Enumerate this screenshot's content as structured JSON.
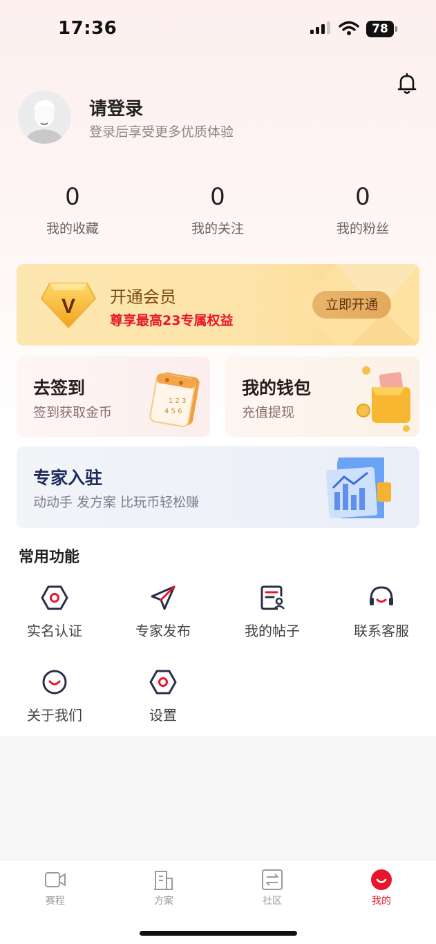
{
  "status_bar": {
    "time": "17:36",
    "battery": "78"
  },
  "profile": {
    "title": "请登录",
    "subtitle": "登录后享受更多优质体验"
  },
  "stats": [
    {
      "value": "0",
      "label": "我的收藏"
    },
    {
      "value": "0",
      "label": "我的关注"
    },
    {
      "value": "0",
      "label": "我的粉丝"
    }
  ],
  "vip": {
    "badge": "V",
    "title": "开通会员",
    "subtitle": "尊享最高23专属权益",
    "button": "立即开通"
  },
  "checkin": {
    "title": "去签到",
    "subtitle": "签到获取金币"
  },
  "wallet": {
    "title": "我的钱包",
    "subtitle": "充值提现"
  },
  "expert": {
    "title": "专家入驻",
    "subtitle": "动动手 发方案 比玩币轻松赚"
  },
  "functions": {
    "title": "常用功能",
    "items": [
      {
        "label": "实名认证",
        "icon": "hexagon-icon"
      },
      {
        "label": "专家发布",
        "icon": "send-icon"
      },
      {
        "label": "我的帖子",
        "icon": "post-icon"
      },
      {
        "label": "联系客服",
        "icon": "headset-icon"
      },
      {
        "label": "关于我们",
        "icon": "smile-icon"
      },
      {
        "label": "设置",
        "icon": "hexagon-icon"
      }
    ]
  },
  "tabbar": {
    "items": [
      {
        "label": "赛程",
        "icon": "video-icon"
      },
      {
        "label": "方案",
        "icon": "document-icon"
      },
      {
        "label": "社区",
        "icon": "exchange-icon"
      },
      {
        "label": "我的",
        "icon": "smile-icon",
        "active": true
      }
    ]
  },
  "colors": {
    "accent": "#e8162a",
    "icon_dark": "#2a2f45",
    "vip_gold": "#fde3a8"
  }
}
